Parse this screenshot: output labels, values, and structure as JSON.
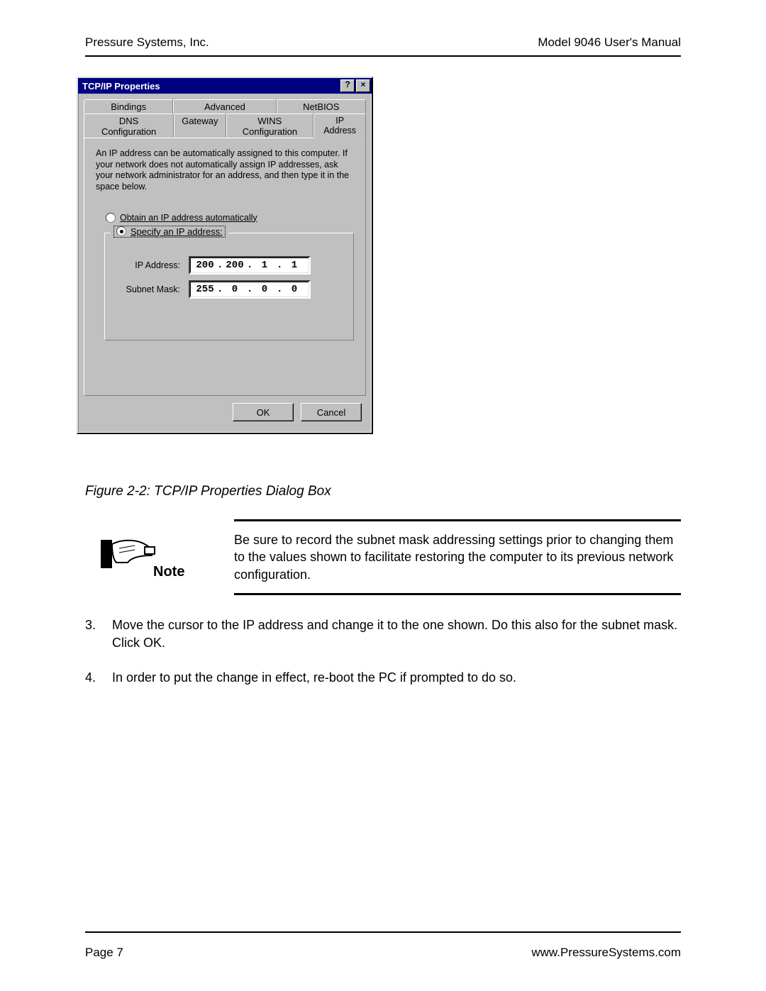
{
  "header": {
    "left": "Pressure Systems, Inc.",
    "right": "Model 9046 User's Manual"
  },
  "dialog": {
    "title": "TCP/IP Properties",
    "help_glyph": "?",
    "close_glyph": "×",
    "tabs_row1": [
      "Bindings",
      "Advanced",
      "NetBIOS"
    ],
    "tabs_row2": [
      "DNS Configuration",
      "Gateway",
      "WINS Configuration",
      "IP Address"
    ],
    "active_tab": "IP Address",
    "intro": "An IP address can be automatically assigned to this computer. If your network does not automatically assign IP addresses, ask your network administrator for an address, and then type it in the space below.",
    "radio_auto": "Obtain an IP address automatically",
    "radio_specify": "Specify an IP address:",
    "ip_label": "IP Address:",
    "ip_value": [
      "200",
      "200",
      "1",
      "1"
    ],
    "mask_label": "Subnet Mask:",
    "mask_value": [
      "255",
      "0",
      "0",
      "0"
    ],
    "ok": "OK",
    "cancel": "Cancel"
  },
  "figure_caption": "Figure 2-2:  TCP/IP Properties Dialog Box",
  "note": {
    "label": "Note",
    "text": "Be sure to record the subnet mask addressing settings prior to changing them to the values shown to facilitate restoring the computer to its previous network configuration."
  },
  "steps": [
    {
      "num": "3.",
      "text": "Move the cursor to the IP address and change it to the one shown. Do this also for the subnet mask. Click OK."
    },
    {
      "num": "4.",
      "text": "In order to put the change in effect, re-boot the PC if prompted to do so."
    }
  ],
  "footer": {
    "left": "Page 7",
    "right": "www.PressureSystems.com"
  }
}
